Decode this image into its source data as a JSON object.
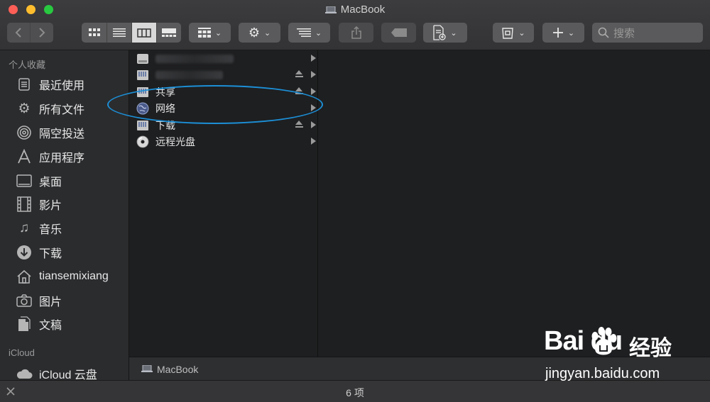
{
  "window": {
    "title": "MacBook"
  },
  "toolbar": {
    "search_placeholder": "搜索"
  },
  "sidebar": {
    "favorites_header": "个人收藏",
    "favorites": [
      {
        "label": "最近使用",
        "icon": "recents-icon"
      },
      {
        "label": "所有文件",
        "icon": "gear-icon"
      },
      {
        "label": "隔空投送",
        "icon": "airdrop-icon"
      },
      {
        "label": "应用程序",
        "icon": "applications-icon"
      },
      {
        "label": "桌面",
        "icon": "desktop-icon"
      },
      {
        "label": "影片",
        "icon": "film-icon"
      },
      {
        "label": "音乐",
        "icon": "music-icon"
      },
      {
        "label": "下载",
        "icon": "downloads-icon"
      },
      {
        "label": "tiansemixiang",
        "icon": "home-icon"
      },
      {
        "label": "图片",
        "icon": "camera-icon"
      },
      {
        "label": "文稿",
        "icon": "document-icon"
      }
    ],
    "icloud_header": "iCloud",
    "icloud_items": [
      {
        "label": "iCloud 云盘",
        "icon": "cloud-icon"
      }
    ]
  },
  "column1": {
    "items": [
      {
        "label": "",
        "icon": "hard-drive-icon",
        "blurred": true,
        "eject": false
      },
      {
        "label": "",
        "icon": "external-drive-icon",
        "blurred": true,
        "eject": true
      },
      {
        "label": "共享",
        "icon": "shared-drive-icon",
        "blurred": false,
        "eject": true
      },
      {
        "label": "网络",
        "icon": "network-globe-icon",
        "blurred": false,
        "eject": false
      },
      {
        "label": "下载",
        "icon": "external-drive-icon",
        "blurred": false,
        "eject": true
      },
      {
        "label": "远程光盘",
        "icon": "optical-disc-icon",
        "blurred": false,
        "eject": false
      }
    ]
  },
  "pathbar": {
    "label": "MacBook"
  },
  "statusbar": {
    "text": "6 项"
  },
  "watermark": {
    "logo": "Bai du",
    "product": "经验",
    "url": "jingyan.baidu.com"
  },
  "colors": {
    "annotation_ellipse": "#1c8fd6",
    "close": "#ff5f57",
    "minimize": "#ffbd2e",
    "maximize": "#28c940"
  }
}
